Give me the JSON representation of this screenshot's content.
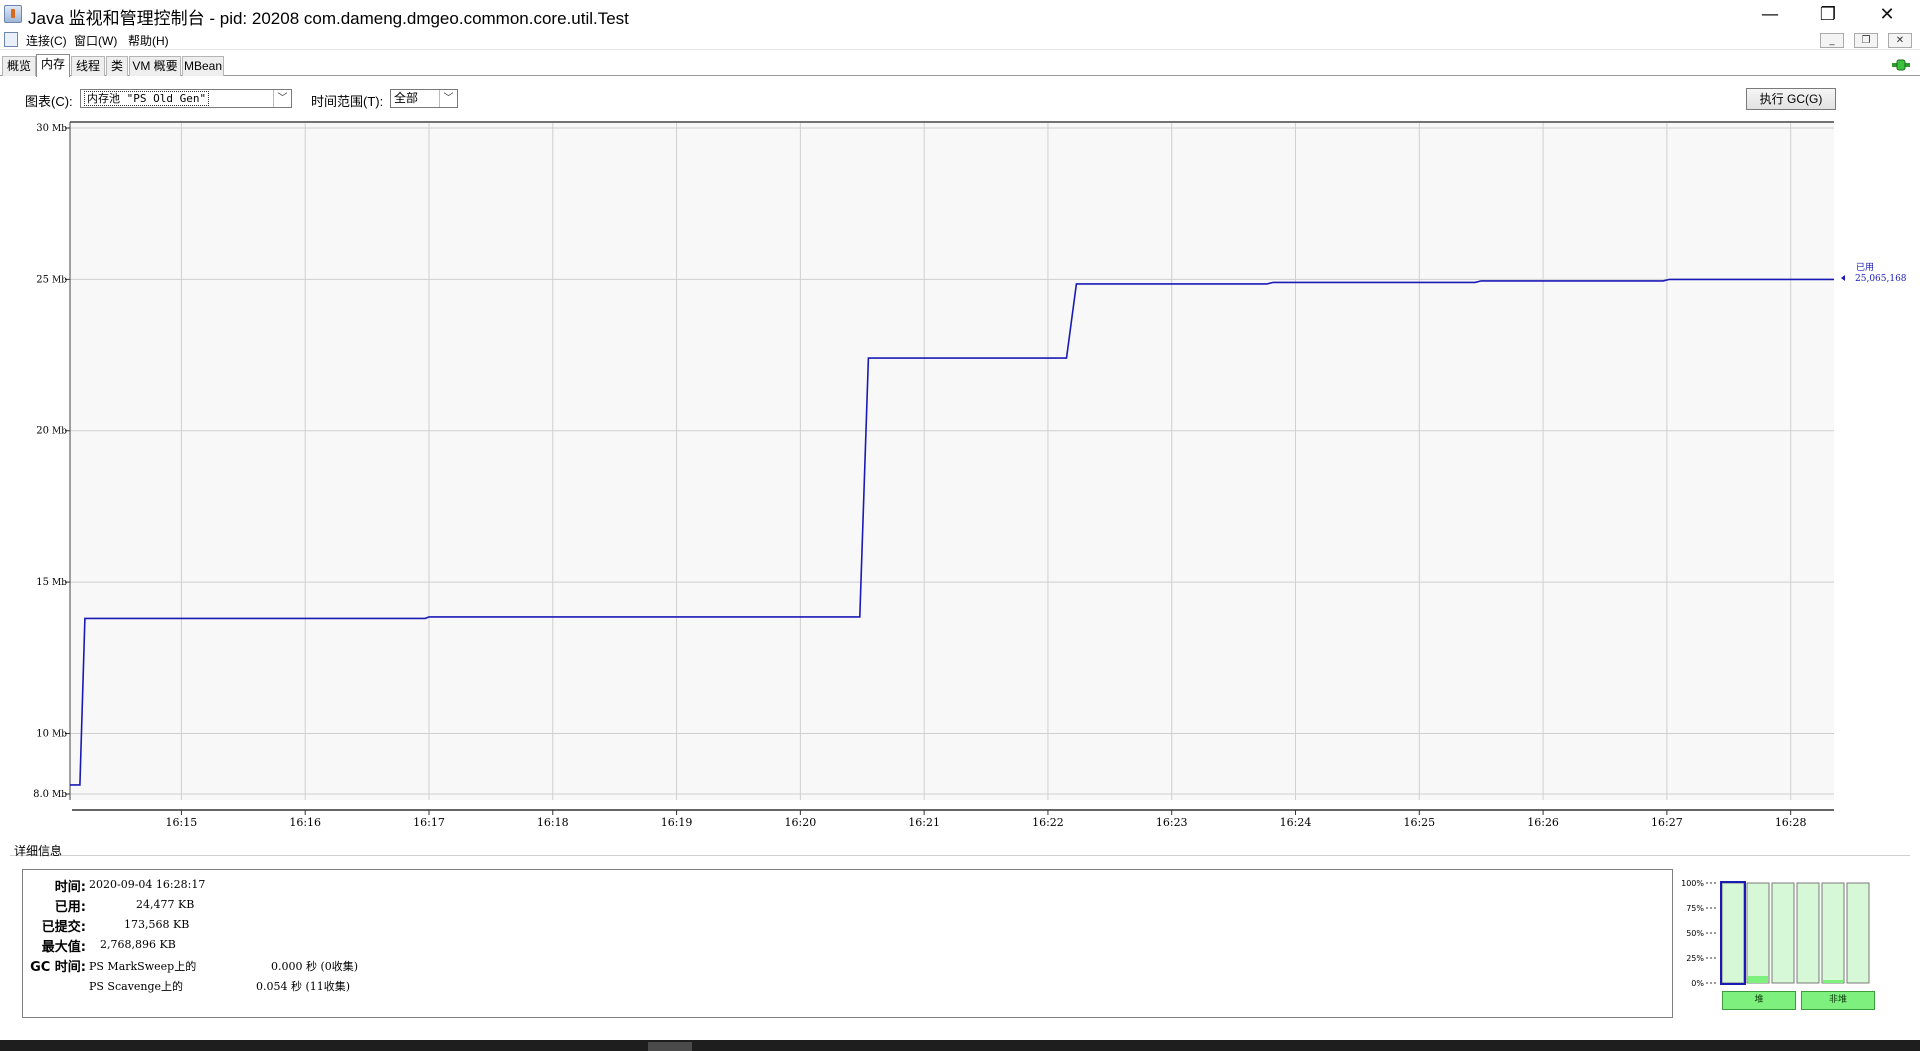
{
  "window": {
    "title": "Java 监视和管理控制台 - pid: 20208 com.dameng.dmgeo.common.core.util.Test",
    "minimize_glyph": "—",
    "restore_glyph": "❐",
    "close_glyph": "✕"
  },
  "menu": {
    "items": [
      "连接(C)",
      "窗口(W)",
      "帮助(H)"
    ],
    "mdi_minimize": "_",
    "mdi_restore": "❐",
    "mdi_close": "✕"
  },
  "tabs": [
    "概览",
    "内存",
    "线程",
    "类",
    "VM 概要",
    "MBean"
  ],
  "active_tab": "内存",
  "controls": {
    "chart_label": "图表(C):",
    "chart_value": "内存池 \"PS Old Gen\"",
    "range_label": "时间范围(T):",
    "range_value": "全部",
    "gc_button": "执行 GC(G)"
  },
  "chart_data": {
    "type": "line",
    "title": "",
    "xlabel": "",
    "ylabel": "",
    "y_unit": "Mb",
    "ylim": [
      8.0,
      30
    ],
    "y_ticks": [
      {
        "value": 30,
        "label": "30 Mb"
      },
      {
        "value": 25,
        "label": "25 Mb"
      },
      {
        "value": 20,
        "label": "20 Mb"
      },
      {
        "value": 15,
        "label": "15 Mb"
      },
      {
        "value": 10,
        "label": "10 Mb"
      },
      {
        "value": 8.0,
        "label": "8.0 Mb"
      }
    ],
    "x_ticks": [
      "16:15",
      "16:16",
      "16:17",
      "16:18",
      "16:19",
      "16:20",
      "16:21",
      "16:22",
      "16:23",
      "16:24",
      "16:25",
      "16:26",
      "16:27",
      "16:28"
    ],
    "xlim_minutes": [
      14.1,
      28.35
    ],
    "grid": true,
    "series": [
      {
        "name": "已用",
        "color": "#1a1ab5",
        "current_value": "25,065,168",
        "points": [
          [
            14.1,
            8.3
          ],
          [
            14.18,
            8.3
          ],
          [
            14.22,
            13.8
          ],
          [
            16.97,
            13.8
          ],
          [
            17.0,
            13.85
          ],
          [
            20.48,
            13.85
          ],
          [
            20.55,
            22.4
          ],
          [
            22.15,
            22.4
          ],
          [
            22.23,
            24.85
          ],
          [
            23.77,
            24.85
          ],
          [
            23.82,
            24.9
          ],
          [
            25.45,
            24.9
          ],
          [
            25.5,
            24.95
          ],
          [
            26.97,
            24.95
          ],
          [
            27.02,
            25.0
          ],
          [
            28.35,
            25.0
          ]
        ]
      }
    ]
  },
  "details": {
    "section_label": "详细信息",
    "time_label": "时间:",
    "time_value": "2020-09-04 16:28:17",
    "used_label": "已用:",
    "used_value": "24,477 KB",
    "committed_label": "已提交:",
    "committed_value": "173,568 KB",
    "max_label": "最大值:",
    "max_value": "2,768,896 KB",
    "gc_label": "GC 时间:",
    "gc_rows": [
      {
        "name": "PS MarkSweep上的",
        "time": "0.000 秒 (0收集)"
      },
      {
        "name": "PS Scavenge上的",
        "time": "0.054 秒 (11收集)"
      }
    ]
  },
  "memory_bars": {
    "scale_labels": [
      "100%",
      "75%",
      "50%",
      "25%",
      "0%"
    ],
    "groups": [
      {
        "label": "堆",
        "levels": [
          0.0,
          0.07,
          0.0
        ]
      },
      {
        "label": "非堆",
        "levels": [
          0.0,
          0.03,
          0.0
        ]
      }
    ],
    "fill_color": "#7df07d",
    "track_color": "#d6f8d6",
    "selected_border": "#1a1ab5"
  }
}
